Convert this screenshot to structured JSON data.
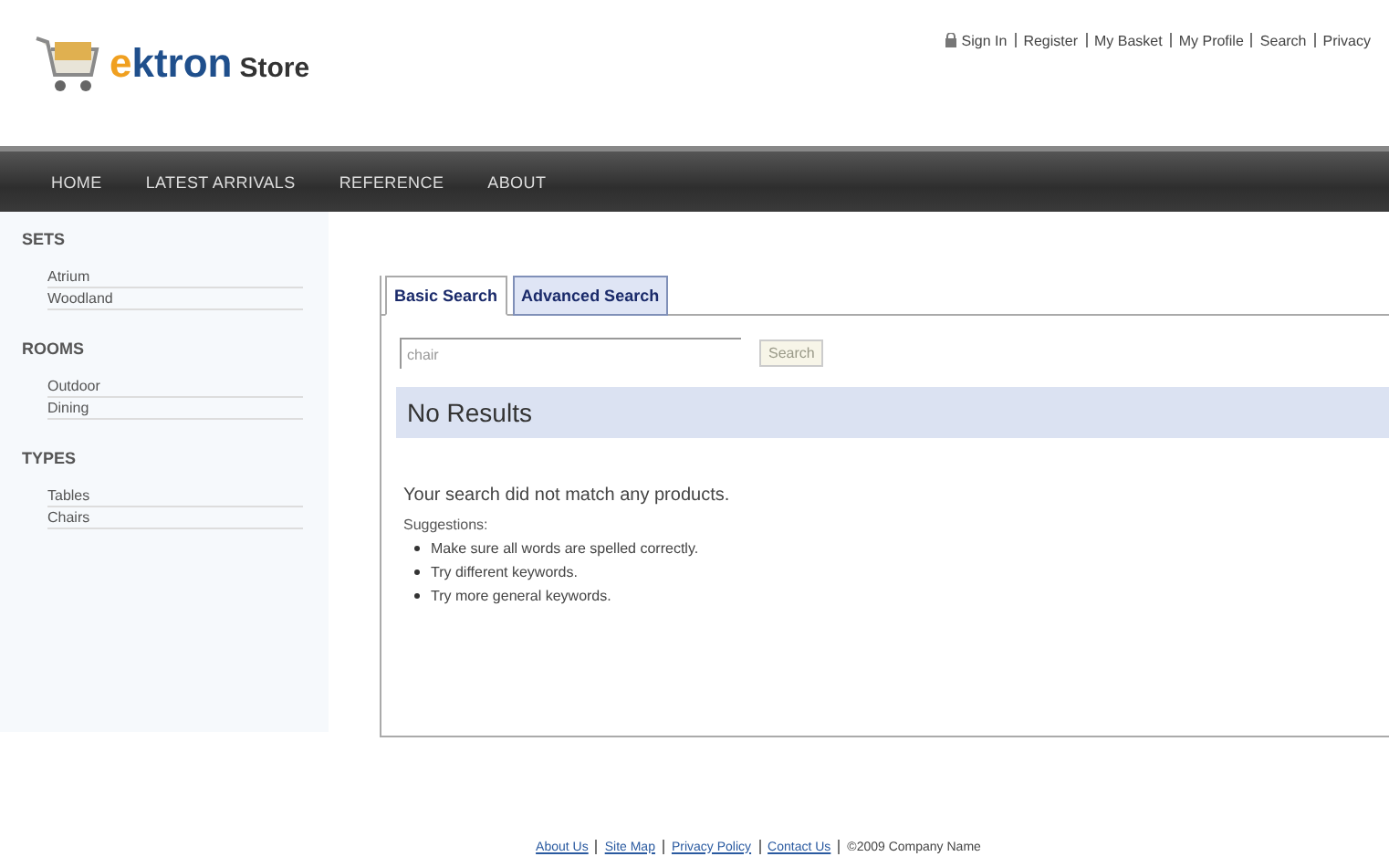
{
  "logo": {
    "brand": "ektron",
    "name": "Store"
  },
  "top_links": [
    "Sign In",
    "Register",
    "My Basket",
    "My Profile",
    "Search",
    "Privacy"
  ],
  "nav": [
    "HOME",
    "LATEST ARRIVALS",
    "REFERENCE",
    "ABOUT"
  ],
  "sidebar": [
    {
      "heading": "SETS",
      "items": [
        "Atrium",
        "Woodland"
      ]
    },
    {
      "heading": "ROOMS",
      "items": [
        "Outdoor",
        "Dining"
      ]
    },
    {
      "heading": "TYPES",
      "items": [
        "Tables",
        "Chairs"
      ]
    }
  ],
  "tabs": [
    {
      "label": "Basic Search",
      "selected": true
    },
    {
      "label": "Advanced Search",
      "selected": false
    }
  ],
  "search": {
    "value": "chair",
    "button": "Search"
  },
  "results": {
    "title": "No Results",
    "message": "Your search did not match any products.",
    "suggestions_label": "Suggestions:",
    "suggestions": [
      "Make sure all words are spelled correctly.",
      "Try different keywords.",
      "Try more general keywords."
    ]
  },
  "footer": {
    "links": [
      "About Us",
      "Site Map",
      "Privacy Policy",
      "Contact Us"
    ],
    "copyright": "©2009 Company Name"
  }
}
